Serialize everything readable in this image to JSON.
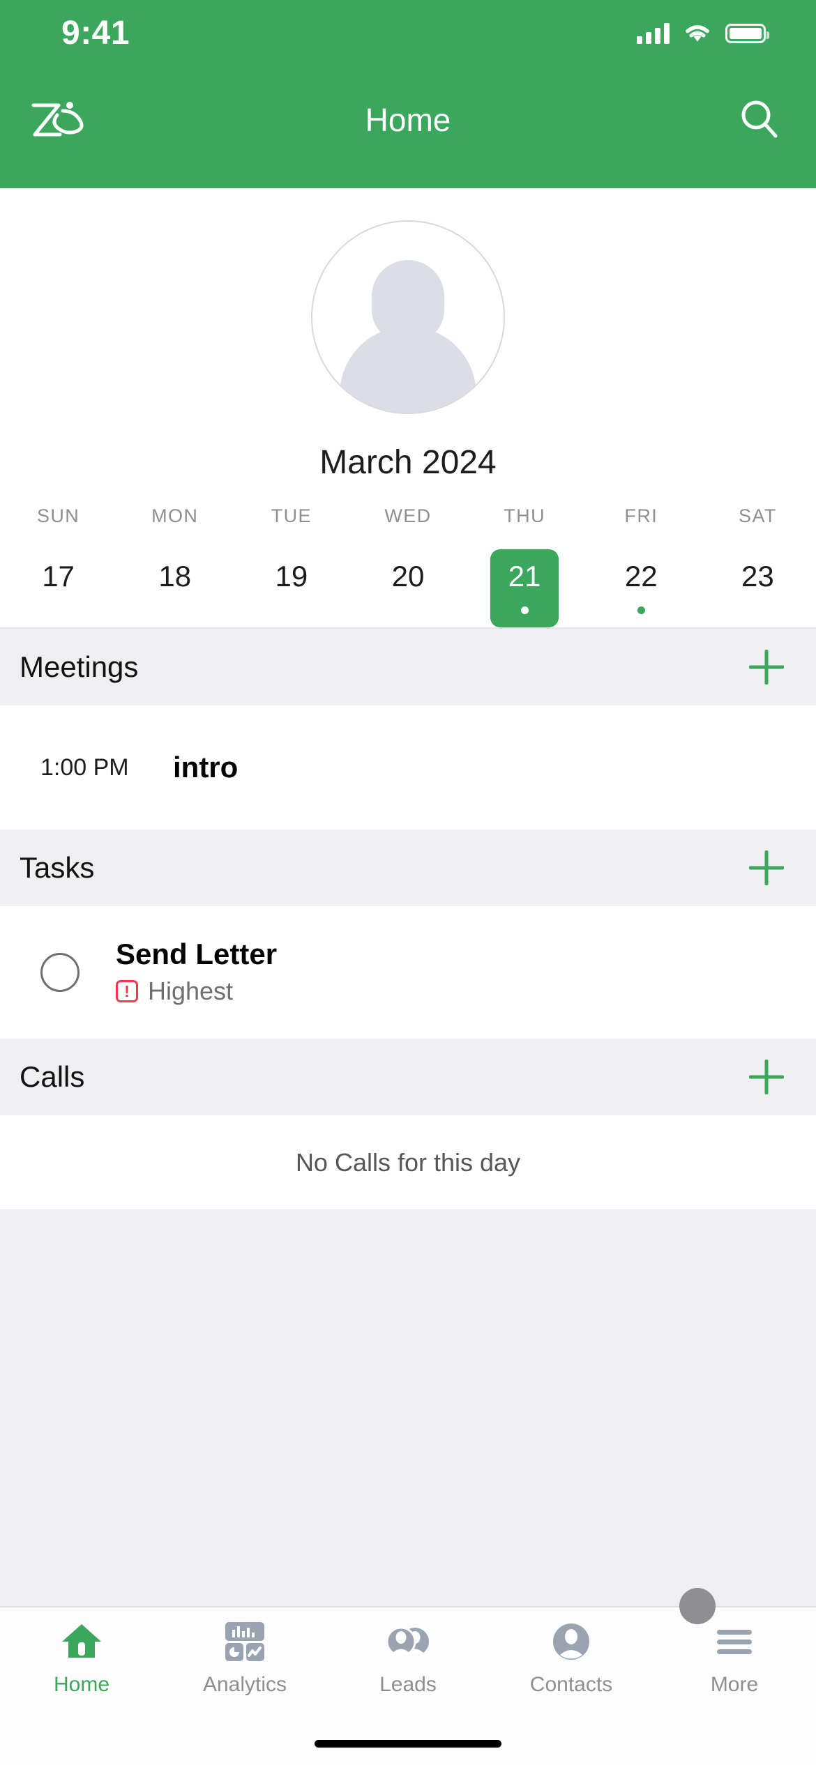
{
  "theme": {
    "brand_green": "#3AA75C",
    "section_bg": "#f0f0f2",
    "priority_red": "#ee3b4b",
    "muted_gray": "#8e8e93"
  },
  "status_bar": {
    "time": "9:41",
    "signal_icon": "cellular-signal-icon",
    "wifi_icon": "wifi-icon",
    "battery_icon": "battery-full-icon"
  },
  "nav": {
    "logo_name": "zia-logo",
    "title": "Home",
    "search_icon": "search-icon"
  },
  "profile": {
    "avatar_name": "user-avatar-placeholder"
  },
  "calendar": {
    "month_label": "March 2024",
    "weekday_labels": [
      "SUN",
      "MON",
      "TUE",
      "WED",
      "THU",
      "FRI",
      "SAT"
    ],
    "days": [
      {
        "date": "17",
        "selected": false,
        "dot": "none"
      },
      {
        "date": "18",
        "selected": false,
        "dot": "none"
      },
      {
        "date": "19",
        "selected": false,
        "dot": "none"
      },
      {
        "date": "20",
        "selected": false,
        "dot": "none"
      },
      {
        "date": "21",
        "selected": true,
        "dot": "white"
      },
      {
        "date": "22",
        "selected": false,
        "dot": "green"
      },
      {
        "date": "23",
        "selected": false,
        "dot": "none"
      }
    ]
  },
  "sections": {
    "meetings": {
      "title": "Meetings",
      "add_label": "+",
      "items": [
        {
          "time": "1:00 PM",
          "name": "intro"
        }
      ]
    },
    "tasks": {
      "title": "Tasks",
      "add_label": "+",
      "items": [
        {
          "title": "Send Letter",
          "priority": "Highest",
          "priority_mark": "!",
          "completed": false
        }
      ]
    },
    "calls": {
      "title": "Calls",
      "add_label": "+",
      "empty_text": "No Calls for this day",
      "items": []
    }
  },
  "tabbar": {
    "items": [
      {
        "label": "Home",
        "icon": "home-icon",
        "active": true
      },
      {
        "label": "Analytics",
        "icon": "analytics-dashboard-icon",
        "active": false
      },
      {
        "label": "Leads",
        "icon": "leads-people-icon",
        "active": false
      },
      {
        "label": "Contacts",
        "icon": "contact-person-icon",
        "active": false
      },
      {
        "label": "More",
        "icon": "hamburger-menu-icon",
        "active": false
      }
    ]
  }
}
